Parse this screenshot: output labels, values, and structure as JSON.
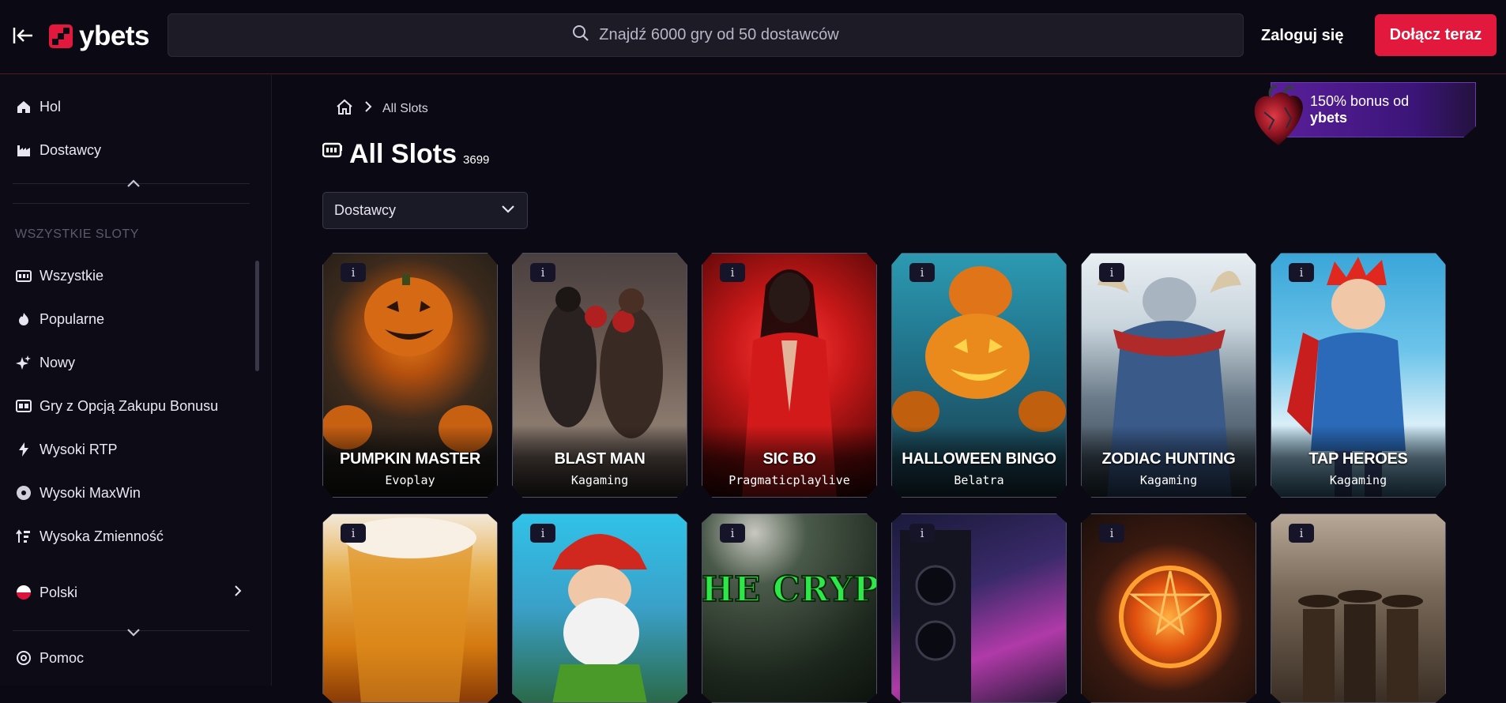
{
  "header": {
    "logo_text": "ybets",
    "search_placeholder": "Znajdź 6000 gry od 50 dostawców",
    "login_label": "Zaloguj się",
    "join_label": "Dołącz teraz"
  },
  "sidebar": {
    "top_items": [
      {
        "label": "Hol",
        "icon": "home-icon"
      },
      {
        "label": "Dostawcy",
        "icon": "factory-icon"
      }
    ],
    "section_label": "WSZYSTKIE SLOTY",
    "items": [
      {
        "label": "Wszystkie",
        "icon": "slot-machine-icon"
      },
      {
        "label": "Popularne",
        "icon": "flame-icon"
      },
      {
        "label": "Nowy",
        "icon": "sparkle-icon"
      },
      {
        "label": "Gry z Opcją Zakupu Bonusu",
        "icon": "bonus-buy-icon"
      },
      {
        "label": "Wysoki RTP",
        "icon": "lightning-icon"
      },
      {
        "label": "Wysoki MaxWin",
        "icon": "swirl-icon"
      },
      {
        "label": "Wysoka Zmienność",
        "icon": "volatility-icon"
      }
    ],
    "language_label": "Polski",
    "help_label": "Pomoc"
  },
  "breadcrumb": {
    "current": "All Slots"
  },
  "page": {
    "title": "All Slots",
    "count": "3699"
  },
  "filter": {
    "providers_label": "Dostawcy"
  },
  "promo": {
    "line1": "150% bonus od",
    "line2": "ybets"
  },
  "games": [
    {
      "name": "PUMPKIN MASTER",
      "provider": "Evoplay"
    },
    {
      "name": "BLAST MAN",
      "provider": "Kagaming"
    },
    {
      "name": "SIC BO",
      "provider": "Pragmaticplaylive"
    },
    {
      "name": "HALLOWEEN BINGO",
      "provider": "Belatra"
    },
    {
      "name": "ZODIAC HUNTING",
      "provider": "Kagaming"
    },
    {
      "name": "TAP HEROES",
      "provider": "Kagaming"
    },
    {
      "name": "",
      "provider": ""
    },
    {
      "name": "",
      "provider": ""
    },
    {
      "name": "THE CRYPT",
      "provider": ""
    },
    {
      "name": "",
      "provider": ""
    },
    {
      "name": "",
      "provider": ""
    },
    {
      "name": "",
      "provider": ""
    }
  ],
  "info_glyph": "i",
  "colors": {
    "accent": "#e2183d",
    "background": "#0b0913",
    "sidebar": "#0d0c16",
    "promo": "#5a1f9b"
  }
}
